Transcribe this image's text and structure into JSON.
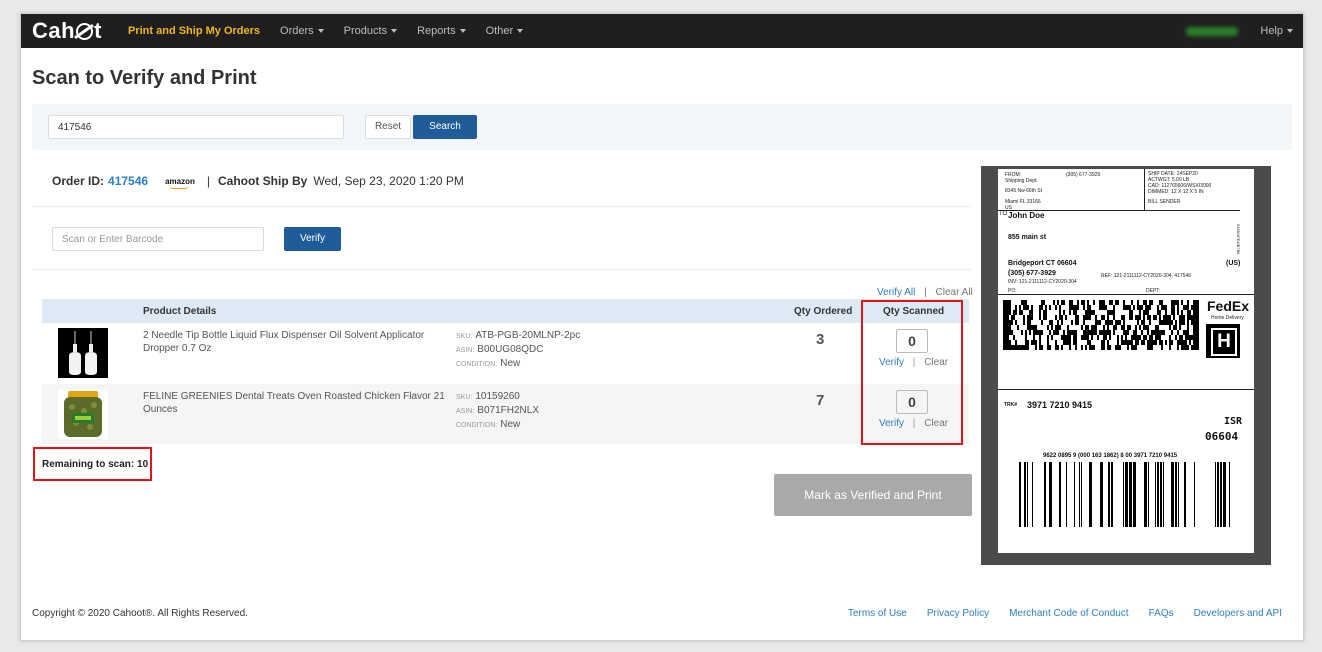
{
  "nav": {
    "logo": "Cahoot",
    "items": [
      {
        "label": "Print and Ship My Orders",
        "active": true,
        "caret": false
      },
      {
        "label": "Orders",
        "active": false,
        "caret": true
      },
      {
        "label": "Products",
        "active": false,
        "caret": true
      },
      {
        "label": "Reports",
        "active": false,
        "caret": true
      },
      {
        "label": "Other",
        "active": false,
        "caret": true
      }
    ],
    "help": "Help"
  },
  "page": {
    "title": "Scan to Verify and Print"
  },
  "search": {
    "value": "417546",
    "reset": "Reset",
    "search": "Search"
  },
  "order": {
    "id_label": "Order ID:",
    "id": "417546",
    "marketplace": "amazon",
    "separator": "|",
    "ship_by_label": "Cahoot Ship By",
    "ship_by": "Wed, Sep 23, 2020 1:20 PM"
  },
  "scan": {
    "placeholder": "Scan or Enter Barcode",
    "verify": "Verify"
  },
  "bulk": {
    "verify_all": "Verify All",
    "sep": "|",
    "clear_all": "Clear All"
  },
  "table": {
    "headers": {
      "product": "Product Details",
      "qty_ordered": "Qty Ordered",
      "qty_scanned": "Qty Scanned"
    },
    "rows": [
      {
        "name": "2 Needle Tip Bottle Liquid Flux Dispenser Oil Solvent Applicator Dropper 0.7 Oz",
        "sku_k": "SKU:",
        "sku": "ATB-PGB-20MLNP-2pc",
        "asin_k": "ASIN:",
        "asin": "B00UG08QDC",
        "cond_k": "CONDITION:",
        "cond": "New",
        "qty_ordered": "3",
        "qty_scanned": "0",
        "verify": "Verify",
        "sep": "|",
        "clear": "Clear"
      },
      {
        "name": "FELINE GREENIES Dental Treats Oven Roasted Chicken Flavor 21 Ounces",
        "sku_k": "SKU:",
        "sku": "10159260",
        "asin_k": "ASIN:",
        "asin": "B071FH2NLX",
        "cond_k": "CONDITION:",
        "cond": "New",
        "qty_ordered": "7",
        "qty_scanned": "0",
        "verify": "Verify",
        "sep": "|",
        "clear": "Clear"
      }
    ]
  },
  "remaining": "Remaining to scan: 10",
  "mark_button": "Mark as Verified and Print",
  "label": {
    "from1": "FROM:",
    "from2": "Shipping Dept.",
    "phone_top": "(305) 677-3929",
    "addr1": "8345 Nw 66th St",
    "addr2": "Miami FL 33166",
    "country_top": "US",
    "ship_date": "SHIP DATE: 24SEP20",
    "actwgt": "ACTWGT: 5.00 LB",
    "cad": "CAD: 112765606/WSXI3000",
    "dims": "DIMMED: 12 X 12 X 5 IN",
    "bill": "BILL SENDER",
    "to": "TO",
    "to_name": "John Doe",
    "to_street": "855 main st",
    "to_city": "Bridgeport CT 06604",
    "to_phone": "(305) 677-3929",
    "to_country": "(US)",
    "ref": "REF: 121-2111112-CY2020-304, 417546",
    "inv": "INV: 121-2111112-CY2020-304",
    "po": "PO:",
    "dept": "DEPT:",
    "side_code": "5356/1FE4/B7B6",
    "fedex": "FedEx",
    "fedex_service": "Home Delivery",
    "h": "H",
    "trk_k": "TRK#",
    "trk": "3971 7210 9415",
    "isr": "ISR",
    "zip": "06604",
    "barcode_text": "9622 0895 9 (000 163 1862) 8 00 3971 7210 9415"
  },
  "footer": {
    "copyright": "Copyright © 2020 Cahoot®. All Rights Reserved.",
    "links": [
      "Terms of Use",
      "Privacy Policy",
      "Merchant Code of Conduct",
      "FAQs",
      "Developers and API"
    ]
  }
}
